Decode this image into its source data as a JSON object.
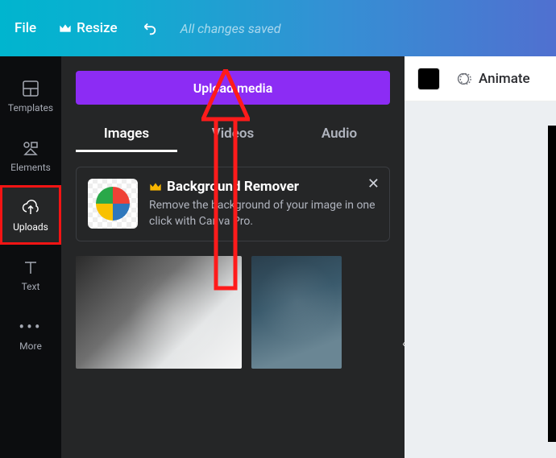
{
  "topbar": {
    "file": "File",
    "resize": "Resize",
    "saved_status": "All changes saved"
  },
  "leftnav": {
    "templates": "Templates",
    "elements": "Elements",
    "uploads": "Uploads",
    "text": "Text",
    "more": "More"
  },
  "panel": {
    "upload_button": "Upload media",
    "tabs": {
      "images": "Images",
      "videos": "Videos",
      "audio": "Audio"
    },
    "promo": {
      "title": "Background Remover",
      "desc": "Remove the background of your image in one click with Canva Pro."
    }
  },
  "canvas": {
    "animate": "Animate",
    "swatch_color": "#000000"
  },
  "annotation": {
    "uploads_highlighted": true,
    "arrow_points_to": "upload-media-button"
  }
}
